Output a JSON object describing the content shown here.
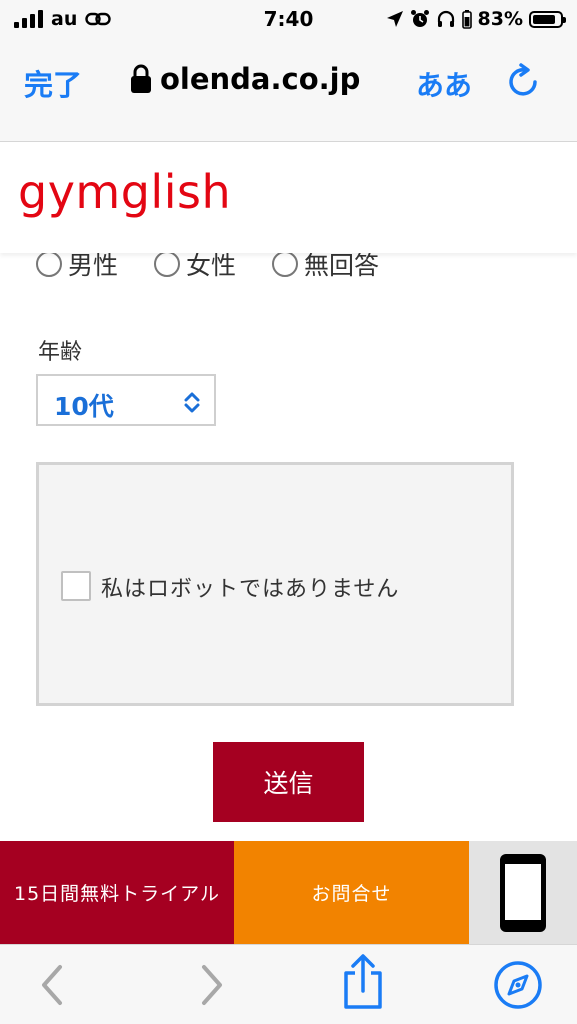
{
  "status_bar": {
    "carrier": "au",
    "time": "7:40",
    "battery_percent": "83%",
    "battery_level": 0.83,
    "signal_bars": 4
  },
  "browser": {
    "done_label": "完了",
    "url": "olenda.co.jp",
    "text_size_label": "ああ",
    "accent_color": "#1a7cf5"
  },
  "site": {
    "logo_text": "gymglish",
    "logo_color": "#e30613"
  },
  "form": {
    "gender_options": [
      "男性",
      "女性",
      "無回答"
    ],
    "age_label": "年齢",
    "age_value": "10代",
    "captcha_label": "私はロボットではありません",
    "submit_label": "送信",
    "submit_color": "#a50021"
  },
  "cta": {
    "trial_label": "15日間無料トライアル",
    "contact_label": "お問合せ",
    "trial_color": "#a50021",
    "contact_color": "#f28300"
  },
  "icons": {
    "back": "chevron-left-icon",
    "forward": "chevron-right-icon",
    "share": "share-icon",
    "compass": "compass-icon",
    "phone": "smartphone-icon"
  }
}
